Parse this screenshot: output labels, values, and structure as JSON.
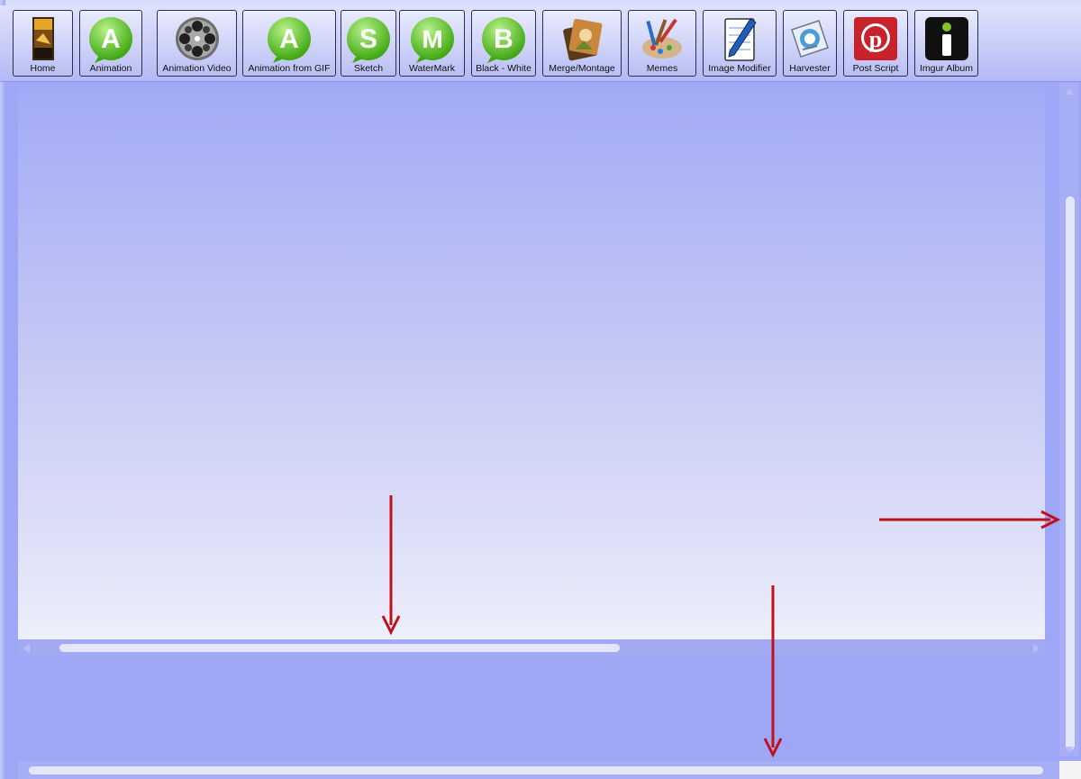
{
  "toolbar": {
    "buttons": [
      {
        "label": "Home",
        "icon": "home-book-icon"
      },
      {
        "label": "Animation",
        "icon": "animation-a-icon"
      },
      {
        "label": "Animation Video",
        "icon": "film-reel-icon"
      },
      {
        "label": "Animation from GIF",
        "icon": "animation-gif-a-icon"
      },
      {
        "label": "Sketch",
        "icon": "sketch-s-icon"
      },
      {
        "label": "WaterMark",
        "icon": "watermark-m-icon"
      },
      {
        "label": "Black - White",
        "icon": "black-white-b-icon"
      },
      {
        "label": "Merge/Montage",
        "icon": "merge-montage-icon"
      },
      {
        "label": "Memes",
        "icon": "memes-brushes-icon"
      },
      {
        "label": "Image Modifier",
        "icon": "notepad-pen-icon"
      },
      {
        "label": "Harvester",
        "icon": "harvester-icon"
      },
      {
        "label": "Post Script",
        "icon": "pinterest-icon"
      },
      {
        "label": "Imgur Album",
        "icon": "imgur-i-icon"
      }
    ]
  },
  "colors": {
    "window_background": "#9ea6f6",
    "green_badge": "#5cc81e",
    "annotation_arrow": "#c0111b"
  }
}
